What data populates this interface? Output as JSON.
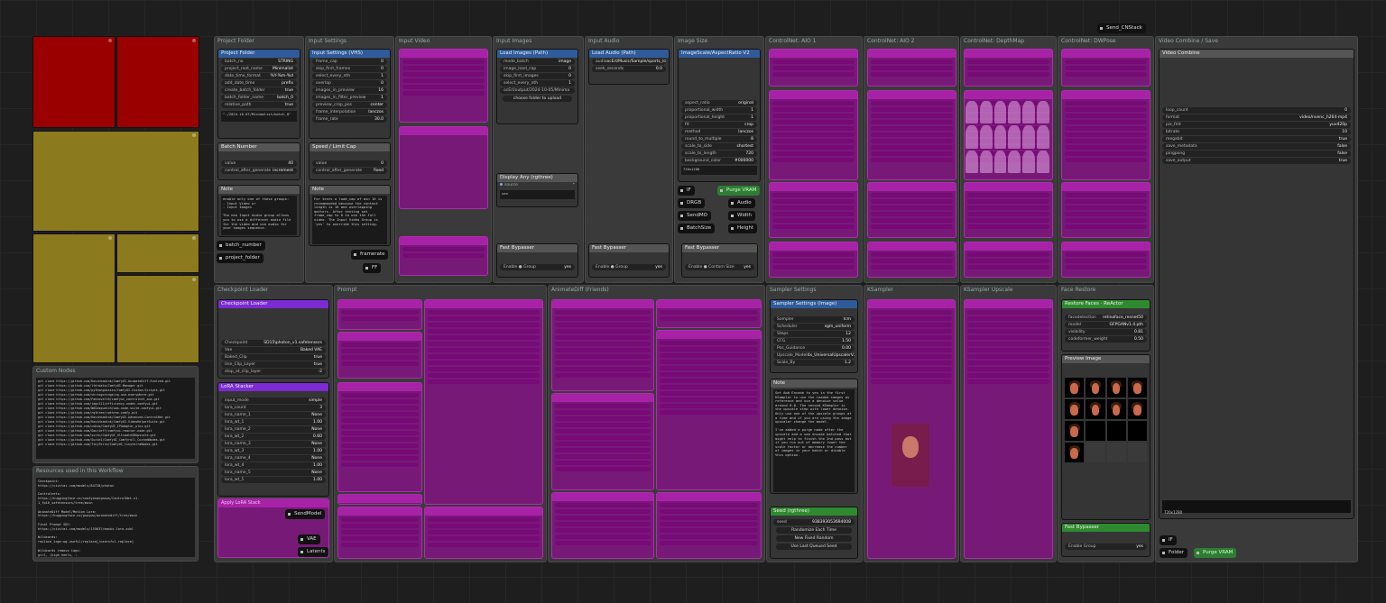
{
  "colors": {
    "muted": "#aa00aa",
    "node_blue": "#2f5b9a",
    "node_purple": "#7b2bd1",
    "node_green": "#2f8a2f",
    "tile_red": "#9b0000",
    "tile_gold": "#8c7a1e"
  },
  "topright_pill": "Send_CNStack",
  "groups": {
    "project_folder": "Project Folder",
    "input_settings": "Input Settings",
    "input_video": "Input Video",
    "input_images": "Input Images",
    "input_audio": "Input Audio",
    "image_size": "Image Size",
    "cn1": "ControlNet: AIO 1",
    "cn2": "ControlNet: AIO 2",
    "cn3": "ControlNet: DepthMap",
    "cn4": "ControlNet: DWPose",
    "video_combine": "Video Combine / Save",
    "checkpoint": "Checkpoint Loader",
    "prompt": "Prompt",
    "animatediff": "AnimateDiff (Friends)",
    "sampler": "Sampler Settings",
    "ksampler": "KSampler",
    "upscale": "KSampler Upscale",
    "face": "Face Restore",
    "custom_nodes": "Custom Nodes",
    "resources": "Resources used in this Workflow"
  },
  "project_node": {
    "title": "Project Folder",
    "rows": [
      {
        "k": "batch_no",
        "v": "STRING"
      },
      {
        "k": "project_root_name",
        "v": "Minimalist"
      },
      {
        "k": "date_time_format",
        "v": "%Y-%m-%d"
      },
      {
        "k": "add_date_time",
        "v": "prefix"
      },
      {
        "k": "create_batch_folder",
        "v": "true"
      },
      {
        "k": "batch_folder_name",
        "v": "batch_0"
      },
      {
        "k": "relative_path",
        "v": "true"
      }
    ],
    "path": "\"./2024-10-07/Minimalist/batch_0\""
  },
  "batch_node": {
    "title": "Batch Number",
    "rows": [
      {
        "k": "value",
        "v": "40"
      },
      {
        "k": "control_after_generate",
        "v": "increment"
      }
    ]
  },
  "note1": {
    "title": "Note",
    "text": "enable only one of these groups:\n- Input Video or\n- Input Images\n\nThe new Input Audio group allows you to use a different audio file for the video and use audio for your images sequence."
  },
  "settings_node": {
    "title": "Input Settings (VHS)",
    "rows": [
      {
        "k": "frame_cap",
        "v": "0"
      },
      {
        "k": "skip_first_frames",
        "v": "0"
      },
      {
        "k": "select_every_nth",
        "v": "1"
      },
      {
        "k": "overlap",
        "v": "0"
      },
      {
        "k": "images_in_preview",
        "v": "16"
      },
      {
        "k": "images_in_filter_preview",
        "v": "1"
      },
      {
        "k": "preview_crop_pos",
        "v": "center"
      },
      {
        "k": "frame_interpolation",
        "v": "lanczos"
      },
      {
        "k": "frame_rate",
        "v": "30.0"
      }
    ]
  },
  "speed_node": {
    "title": "Speed / Limit Cap",
    "rows": [
      {
        "k": "value",
        "v": "0"
      },
      {
        "k": "control_after_generate",
        "v": "fixed"
      }
    ]
  },
  "note2": {
    "title": "Note",
    "text": "For tests a load_cap of min 16 is recommended because the context length is 16 and overlapping matters. After testing set frame_cap to 0 to use the full video. The Input Video Group is 'yes' to override this setting."
  },
  "left_pills": [
    "batch_number",
    "project_folder"
  ],
  "mid_pills": [
    "framerate",
    "FF"
  ],
  "images_node": {
    "title": "Load Images (Path)",
    "rows": [
      {
        "k": "mode_batch",
        "v": "image"
      },
      {
        "k": "image_load_cap",
        "v": "0"
      },
      {
        "k": "skip_first_images",
        "v": "0"
      },
      {
        "k": "select_every_nth",
        "v": "1"
      }
    ],
    "path": "ocErl/output/2024-10-05/Minima",
    "upload": "choose folder to upload"
  },
  "audio_node": {
    "title": "Load Audio (Path)",
    "rows": [
      {
        "k": "audio",
        "v": "ocErl/Music/Sample/sports_loop"
      },
      {
        "k": "seek_seconds",
        "v": "0.0"
      }
    ]
  },
  "display_node": {
    "title": "Display Any (rgthree)",
    "rows": [
      {
        "k": "source",
        "v": "*"
      }
    ],
    "val": "nan"
  },
  "size_node": {
    "title": "ImageScale/AspectRatio V2",
    "rows": [
      {
        "k": "aspect_ratio",
        "v": "original"
      },
      {
        "k": "proportional_width",
        "v": "1"
      },
      {
        "k": "proportional_height",
        "v": "1"
      },
      {
        "k": "fit",
        "v": "crop"
      },
      {
        "k": "method",
        "v": "lanczos"
      },
      {
        "k": "round_to_multiple",
        "v": "8"
      },
      {
        "k": "scale_to_side",
        "v": "shortest"
      },
      {
        "k": "scale_to_length",
        "v": "720"
      },
      {
        "k": "background_color",
        "v": "#000000"
      }
    ],
    "res": "720x1280"
  },
  "size_pills": {
    "left": [
      "IF",
      "DRGB",
      "SendMO",
      "BatchSize"
    ],
    "right": [
      "Purge VRAM",
      "Audio",
      "Width",
      "Height"
    ]
  },
  "fast_bypass": {
    "title": "Fast Bypasser",
    "enable": "Enable ● Group",
    "val": "yes",
    "enable2": "Enable ● Contorn Size"
  },
  "video_node": {
    "title": "Video Combine",
    "rows": [
      {
        "k": "loop_count",
        "v": "0"
      },
      {
        "k": "format",
        "v": "video/nvenc_h264-mp4"
      },
      {
        "k": "pix_fmt",
        "v": "yuv420p"
      },
      {
        "k": "bitrate",
        "v": "10"
      },
      {
        "k": "megabit",
        "v": "true"
      },
      {
        "k": "save_metadata",
        "v": "false"
      },
      {
        "k": "pingpong",
        "v": "false"
      },
      {
        "k": "save_output",
        "v": "true"
      }
    ],
    "res": "720x1280"
  },
  "checkpoint_node": {
    "title": "Checkpoint Loader",
    "rows": [
      {
        "k": "Checkpoint",
        "v": "SD15\\photon_v1.safetensors"
      },
      {
        "k": "Vae",
        "v": "Baked VAE"
      },
      {
        "k": "Baked_Clip",
        "v": "true"
      },
      {
        "k": "Use_Clip_Layer",
        "v": "true"
      },
      {
        "k": "stop_at_clip_layer",
        "v": "-2"
      }
    ]
  },
  "lora_node": {
    "title": "LoRA Stacker",
    "rows": [
      {
        "k": "input_mode",
        "v": "simple"
      },
      {
        "k": "lora_count",
        "v": "3"
      },
      {
        "k": "lora_name_1",
        "v": "None"
      },
      {
        "k": "lora_wt_1",
        "v": "1.00"
      },
      {
        "k": "lora_name_2",
        "v": "None"
      },
      {
        "k": "lora_wt_2",
        "v": "0.60"
      },
      {
        "k": "lora_name_3",
        "v": "None"
      },
      {
        "k": "lora_wt_3",
        "v": "1.00"
      },
      {
        "k": "lora_name_4",
        "v": "None"
      },
      {
        "k": "lora_wt_4",
        "v": "1.00"
      },
      {
        "k": "lora_name_5",
        "v": "None"
      },
      {
        "k": "lora_wt_5",
        "v": "1.00"
      }
    ]
  },
  "lora_pills": [
    "Apply LoRA Stack",
    "SendModel",
    "VAE",
    "Latents"
  ],
  "sampler_node": {
    "title": "Sampler Settings (Image)",
    "rows": [
      {
        "k": "Sampler",
        "v": "lcm"
      },
      {
        "k": "Scheduler",
        "v": "sgm_uniform"
      },
      {
        "k": "Steps",
        "v": "12"
      },
      {
        "k": "CFG",
        "v": "1.50"
      },
      {
        "k": "Pos_Guidance",
        "v": "0.00"
      },
      {
        "k": "Upscale_Model",
        "v": "4x_UniversalUpscalerV2"
      },
      {
        "k": "Scale_By",
        "v": "1.2"
      }
    ]
  },
  "note3": {
    "title": "Note",
    "text": "Set Add Encode to yes in the first KSampler to use the loaded images as reference and use a denoise value around 0.8. The second KSampler is the upscale step with lower denoise. Only use one of the upscale groups at a time and if you are using the image upscaler change the model.\n\nI've added a purge node after the upscale and a vae encode batched that might help to finish the 2nd pass but if you run out of memory lower the scale factor or decrease the number of images in your batch or disable this option."
  },
  "seed_node": {
    "title": "Seed (rgthree)",
    "rows": [
      {
        "k": "seed",
        "v": "938393053694008"
      }
    ],
    "btns": [
      "Randomize Each Time",
      "New Fixed Random",
      "Use Last Queued Seed"
    ]
  },
  "face_node": {
    "title": "Restore Faces",
    "title2": "ReActor",
    "rows": [
      {
        "k": "facedetection",
        "v": "retinaface_resnet50"
      },
      {
        "k": "model",
        "v": "GFPGANv1.4.pth"
      },
      {
        "k": "visibility",
        "v": "0.81"
      },
      {
        "k": "codeformer_weight",
        "v": "0.50"
      }
    ]
  },
  "preview_node": {
    "title": "Preview Image"
  },
  "face_bypass": {
    "title": "Fast Bypasser",
    "enable": "Enable Group",
    "val": "yes"
  },
  "face_pills": [
    "IF",
    "Folder",
    "Purge VRAM"
  ],
  "custom_nodes_text": "git clone https://github.com/Kosinkadink/ComfyUI-AnimateDiff-Evolved.git\ngit clone https://github.com/ltdrdata/ComfyUI-Manager.git\ngit clone https://github.com/pythongosssss/ComfyUI-Custom-Scripts.git\ngit clone https://github.com/chrisgoringe/cg-use-everywhere.git\ngit clone https://github.com/Fannovel16/comfyui_controlnet_aux.git\ngit clone https://github.com/jags111/efficiency-nodes-comfyui.git\ngit clone https://github.com/WASasquatch/was-node-suite-comfyui.git\ngit clone https://github.com/rgthree/rgthree-comfy.git\ngit clone https://github.com/Kosinkadink/ComfyUI-Advanced-ControlNet.git\ngit clone https://github.com/Kosinkadink/ComfyUI-VideoHelperSuite.git\ngit clone https://github.com/cubiq/ComfyUI_IPAdapter_plus.git\ngit clone https://github.com/Gourieff/comfyui-reactor-node.git\ngit clone https://github.com/ssitu/ComfyUI_UltimateSDUpscale.git\ngit clone https://github.com/Suzie1/ComfyUI_Comfyroll_CustomNodes.git\ngit clone https://github.com/TinyTerra/ComfyUI_tinyterraNodes.git",
  "resources_text": "Checkpoint:\nhttps://civitai.com/models/84728/photon\n\nControlnets:\nhttps://huggingface.co/comfyanonymous/ControlNet-v1-1_fp16_safetensors/tree/main\n\nAnimateDiff Model/Motion Lora:\nhttps://huggingface.co/guoyww/animatediff/tree/main\n\nFinal Prompt SDC:\nhttps://civitai.com/models/155637/masks-lora-sdxl\n\nWildcards:\nreplace_tags:wg-useful/replace[/usersful-replace]\n\nWildcards remove tags:\ngirl, (high heels, :"
}
